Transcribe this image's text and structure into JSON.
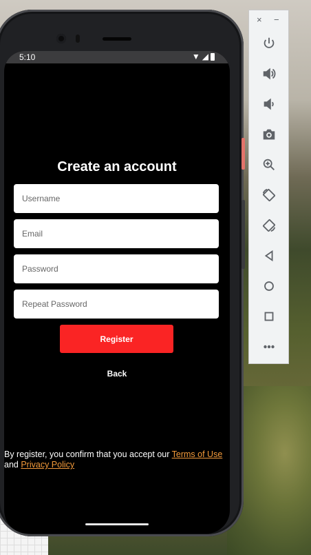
{
  "status_bar": {
    "time": "5:10"
  },
  "screen": {
    "title": "Create an account",
    "fields": {
      "username": {
        "placeholder": "Username",
        "value": ""
      },
      "email": {
        "placeholder": "Email",
        "value": ""
      },
      "password": {
        "placeholder": "Password",
        "value": ""
      },
      "repeat_password": {
        "placeholder": "Repeat Password",
        "value": ""
      }
    },
    "register_label": "Register",
    "back_label": "Back",
    "legal": {
      "prefix": "By register, you confirm that you accept our ",
      "terms_link": "Terms of Use",
      "middle": "and ",
      "privacy_link": "Privacy Policy"
    },
    "colors": {
      "accent": "#fa2424",
      "link": "#f39a3a",
      "background": "#000000"
    }
  },
  "emulator_toolbar": {
    "close_label": "×",
    "minimize_label": "−",
    "buttons": [
      "power-icon",
      "volume-up-icon",
      "volume-down-icon",
      "camera-icon",
      "zoom-icon",
      "rotate-left-icon",
      "rotate-right-icon",
      "back-icon",
      "home-icon",
      "overview-icon",
      "more-icon"
    ]
  }
}
